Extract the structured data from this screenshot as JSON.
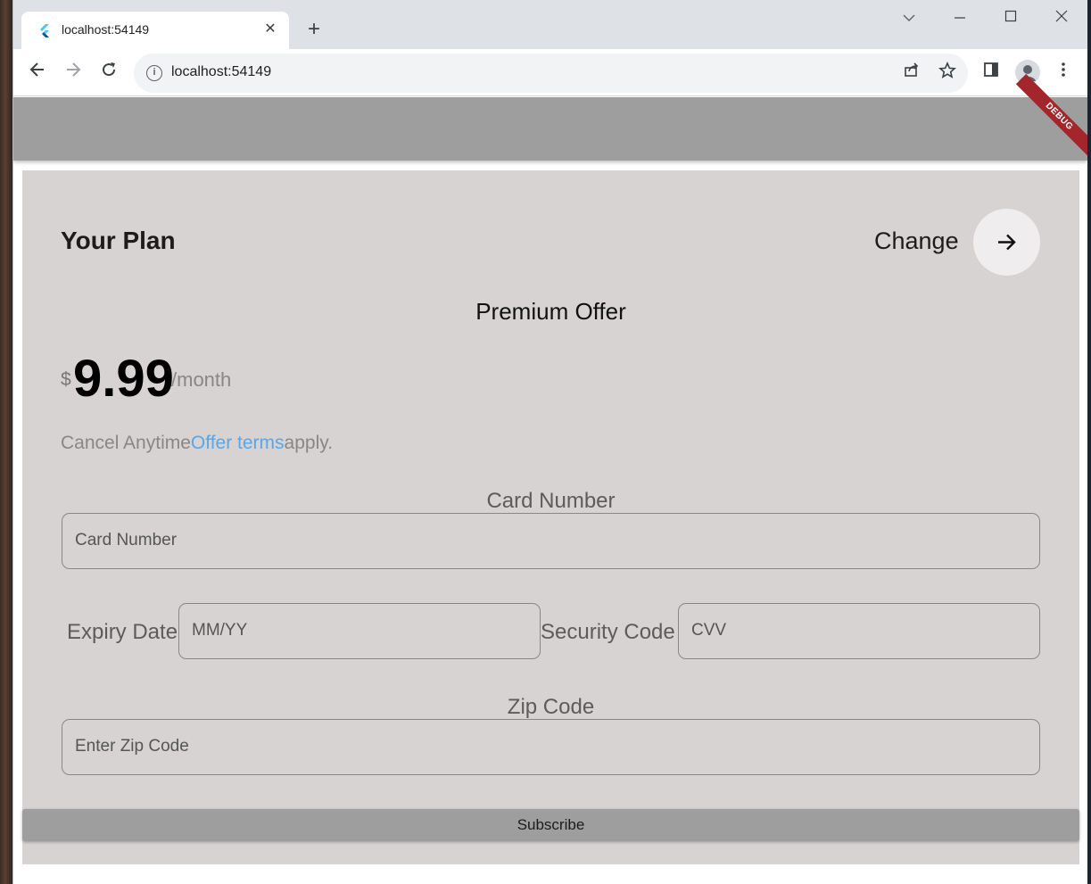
{
  "browser": {
    "tab_title": "localhost:54149",
    "url": "localhost:54149",
    "new_tab_symbol": "+",
    "close_symbol": "✕"
  },
  "app": {
    "debug_banner": "DEBUG",
    "plan": {
      "title": "Your Plan",
      "change_label": "Change",
      "offer_title": "Premium Offer",
      "currency": "$",
      "price": "9.99",
      "period": "/month",
      "cancel_text": "Cancel Anytime",
      "terms_link": "Offer terms",
      "terms_suffix": "apply."
    },
    "form": {
      "card_label": "Card Number",
      "card_placeholder": "Card Number",
      "expiry_label": "Expiry Date",
      "expiry_placeholder": "MM/YY",
      "security_label": "Security Code",
      "security_placeholder": "CVV",
      "zip_label": "Zip Code",
      "zip_placeholder": "Enter Zip Code"
    },
    "subscribe_label": "Subscribe"
  },
  "colors": {
    "appbar": "#9e9e9e",
    "card_background": "#d8d3d3",
    "link": "#5aa6e6",
    "debug_banner": "#a3262b"
  },
  "icons": {
    "tab_favicon": "flutter-icon",
    "change_button": "arrow-right-icon",
    "site_info": "info-icon"
  }
}
